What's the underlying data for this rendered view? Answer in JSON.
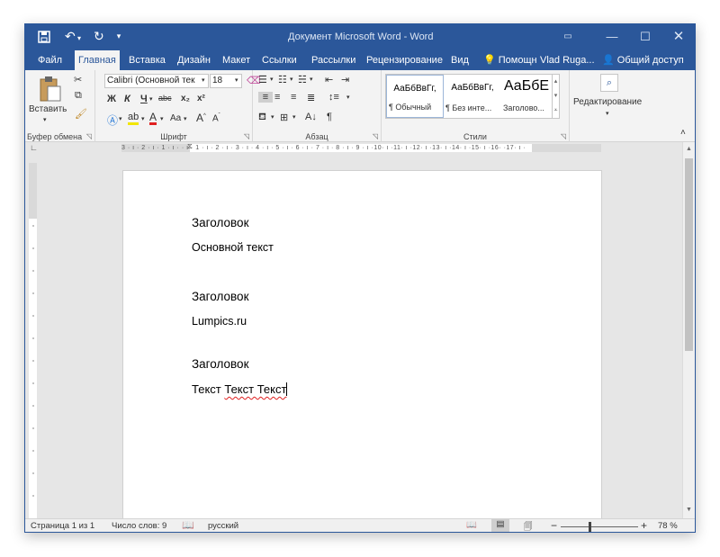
{
  "titlebar": {
    "title": "Документ Microsoft Word - Word",
    "qat_icons": [
      "save-icon",
      "undo-icon",
      "redo-icon",
      "customize-qat-icon"
    ],
    "controls": [
      "ribbon-display-icon",
      "minimize-icon",
      "maximize-icon",
      "close-icon"
    ]
  },
  "tabs": {
    "file": "Файл",
    "home": "Главная",
    "insert": "Вставка",
    "design": "Дизайн",
    "layout": "Макет",
    "references": "Ссылки",
    "mailings": "Рассылки",
    "review": "Рецензирование",
    "view": "Вид",
    "tell_me": "Помощн",
    "user": "Vlad Ruga...",
    "share": "Общий доступ"
  },
  "ribbon": {
    "clipboard": {
      "label": "Буфер обмена",
      "paste": "Вставить"
    },
    "font": {
      "label": "Шрифт",
      "font_name": "Calibri (Основной тек",
      "font_size": "18",
      "bold": "Ж",
      "italic": "К",
      "underline": "Ч",
      "strike": "abc",
      "subscript": "x₂",
      "superscript": "x²",
      "change_case": "Aa",
      "grow": "A",
      "shrink": "A"
    },
    "paragraph": {
      "label": "Абзац"
    },
    "styles": {
      "label": "Стили",
      "items": [
        {
          "sample": "АаБбВвГг,",
          "name": "¶ Обычный"
        },
        {
          "sample": "АаБбВвГг,",
          "name": "¶ Без инте..."
        },
        {
          "sample": "АаБбЕ",
          "name": "Заголово..."
        }
      ]
    },
    "editing": {
      "label": "Редактирование"
    }
  },
  "ruler": {
    "text": "3 · ı · 2 · ı · 1 · ı ·   · ı · 1 · ı · 2 · ı · 3 · ı · 4 · ı · 5 · ı · 6 · ı · 7 · ı · 8 · ı · 9 · ı ·10· ı ·11· ı ·12· ı ·13· ı ·14· ı ·15· ı ·16·   ·17· ı ·"
  },
  "document": {
    "lines": [
      {
        "text": "Заголовок",
        "style": "heading"
      },
      {
        "text": "Основной текст",
        "style": "body"
      },
      {
        "text": "Заголовок",
        "style": "heading"
      },
      {
        "text": "Lumpics.ru",
        "style": "body"
      },
      {
        "text": "Заголовок",
        "style": "heading"
      }
    ],
    "last_line": {
      "first_word": "Текст",
      "misspelled": "Текст Текст"
    }
  },
  "statusbar": {
    "page": "Страница 1 из 1",
    "words": "Число слов: 9",
    "language": "русский",
    "zoom_out": "−",
    "zoom_in": "+",
    "zoom": "78 %",
    "zoom_level_pct": 78
  },
  "colors": {
    "accent": "#2b579a",
    "ribbon_bg": "#f3f3f3",
    "workspace": "#e6e6e6"
  }
}
